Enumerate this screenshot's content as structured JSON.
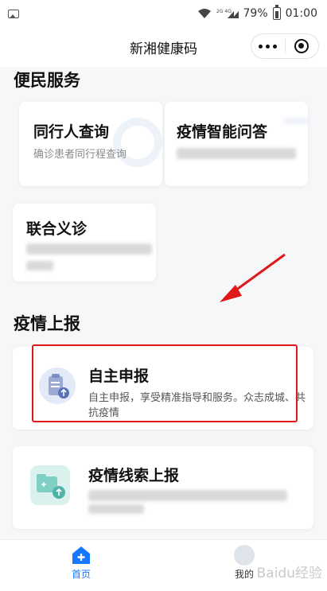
{
  "status_bar": {
    "signal_label": "2G 4G",
    "battery_percent": "79%",
    "time": "01:00"
  },
  "nav": {
    "title": "新湘健康码"
  },
  "sections": {
    "services_title": "便民服务",
    "report_title": "疫情上报"
  },
  "services": [
    {
      "title": "同行人查询",
      "subtitle": "确诊患者同行程查询"
    },
    {
      "title": "疫情智能问答"
    },
    {
      "title": "联合义诊"
    }
  ],
  "reports": [
    {
      "title": "自主申报",
      "description_line1": "自主申报，享受精准指导和服务。众志成城、共",
      "description_line2": "抗疫情"
    },
    {
      "title": "疫情线索上报"
    }
  ],
  "tab_bar": {
    "home_label": "首页",
    "mine_label": "我的",
    "watermark": "Baidu经验"
  },
  "colors": {
    "accent": "#1677ff",
    "highlight_box": "#e01818",
    "arrow": "#e01818"
  }
}
